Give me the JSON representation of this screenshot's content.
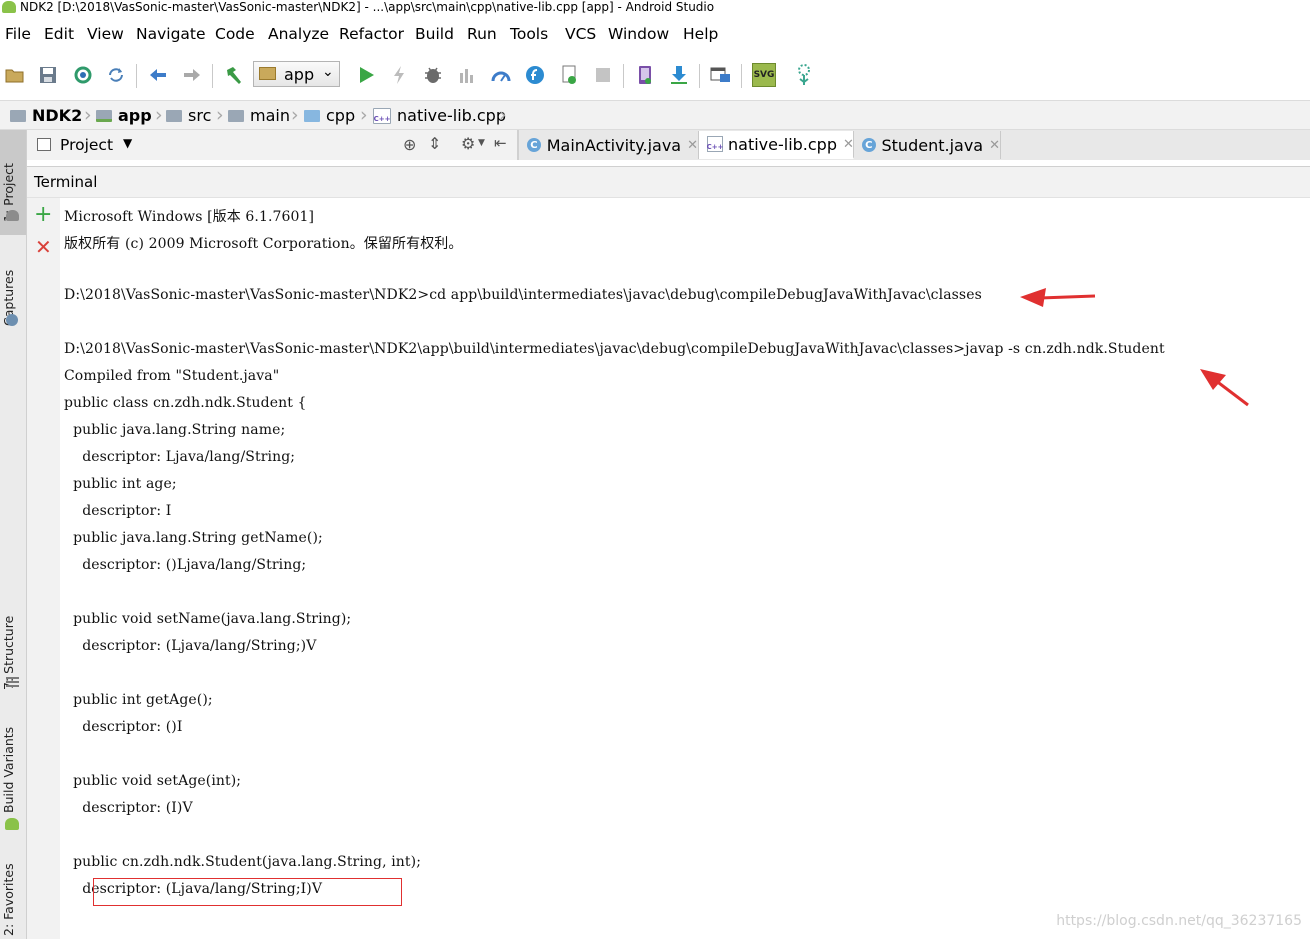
{
  "window": {
    "title": "NDK2 [D:\\2018\\VasSonic-master\\VasSonic-master\\NDK2] - ...\\app\\src\\main\\cpp\\native-lib.cpp [app] - Android Studio"
  },
  "menu": [
    "File",
    "Edit",
    "View",
    "Navigate",
    "Code",
    "Analyze",
    "Refactor",
    "Build",
    "Run",
    "Tools",
    "VCS",
    "Window",
    "Help"
  ],
  "toolbar": {
    "run_config": "app",
    "svg_label": "SVG"
  },
  "breadcrumb": [
    "NDK2",
    "app",
    "src",
    "main",
    "cpp",
    "native-lib.cpp"
  ],
  "side_tabs": {
    "project": "1: Project",
    "captures": "Captures",
    "structure": "7: Structure",
    "build_variants": "Build Variants",
    "favorites": "2: Favorites"
  },
  "project_panel": {
    "label": "Project"
  },
  "editor_tabs": [
    "MainActivity.java",
    "native-lib.cpp",
    "Student.java"
  ],
  "terminal": {
    "title": "Terminal",
    "lines": [
      "Microsoft Windows [版本 6.1.7601]",
      "版权所有 (c) 2009 Microsoft Corporation。保留所有权利。",
      "",
      "D:\\2018\\VasSonic-master\\VasSonic-master\\NDK2>cd app\\build\\intermediates\\javac\\debug\\compileDebugJavaWithJavac\\classes",
      "",
      "D:\\2018\\VasSonic-master\\VasSonic-master\\NDK2\\app\\build\\intermediates\\javac\\debug\\compileDebugJavaWithJavac\\classes>javap -s cn.zdh.ndk.Student",
      "Compiled from \"Student.java\"",
      "public class cn.zdh.ndk.Student {",
      "  public java.lang.String name;",
      "    descriptor: Ljava/lang/String;",
      "  public int age;",
      "    descriptor: I",
      "  public java.lang.String getName();",
      "    descriptor: ()Ljava/lang/String;",
      "",
      "  public void setName(java.lang.String);",
      "    descriptor: (Ljava/lang/String;)V",
      "",
      "  public int getAge();",
      "    descriptor: ()I",
      "",
      "  public void setAge(int);",
      "    descriptor: (I)V",
      "",
      "  public cn.zdh.ndk.Student(java.lang.String, int);",
      "    descriptor: (Ljava/lang/String;I)V"
    ]
  },
  "watermark": "https://blog.csdn.net/qq_36237165",
  "colors": {
    "annotation_red": "#e03030",
    "run_green": "#3aa645"
  }
}
